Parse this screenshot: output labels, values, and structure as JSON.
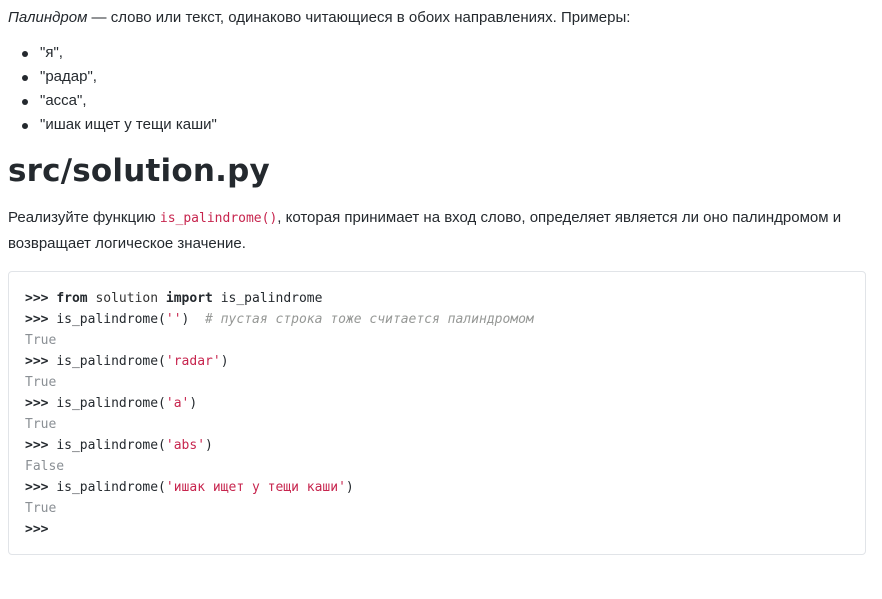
{
  "intro": {
    "term": "Палиндром",
    "text": " — слово или текст, одинаково читающиеся в обоих направлениях. Примеры:"
  },
  "examples": [
    "\"я\",",
    "\"радар\",",
    "\"асса\",",
    "\"ишак ищет у тещи каши\""
  ],
  "heading": "src/solution.py",
  "task": {
    "before": "Реализуйте функцию ",
    "code": "is_palindrome()",
    "after": ", которая принимает на вход слово, определяет является ли оно палиндромом и возвращает логическое значение."
  },
  "code": {
    "prompt": ">>>",
    "line1": {
      "from": "from",
      "module": "solution",
      "import": "import",
      "name": "is_palindrome"
    },
    "line2": {
      "call": "is_palindrome(",
      "arg": "''",
      "close": ")",
      "comment": "# пустая строка тоже считается палиндромом"
    },
    "out2": "True",
    "line3": {
      "call": "is_palindrome(",
      "arg": "'radar'",
      "close": ")"
    },
    "out3": "True",
    "line4": {
      "call": "is_palindrome(",
      "arg": "'a'",
      "close": ")"
    },
    "out4": "True",
    "line5": {
      "call": "is_palindrome(",
      "arg": "'abs'",
      "close": ")"
    },
    "out5": "False",
    "line6": {
      "call": "is_palindrome(",
      "arg": "'ишак ищет у тещи каши'",
      "close": ")"
    },
    "out6": "True"
  },
  "colors": {
    "text": "#24292e",
    "string": "#c7254e",
    "comment": "#969896",
    "output": "#8a8f94",
    "border": "#e1e4e8"
  }
}
